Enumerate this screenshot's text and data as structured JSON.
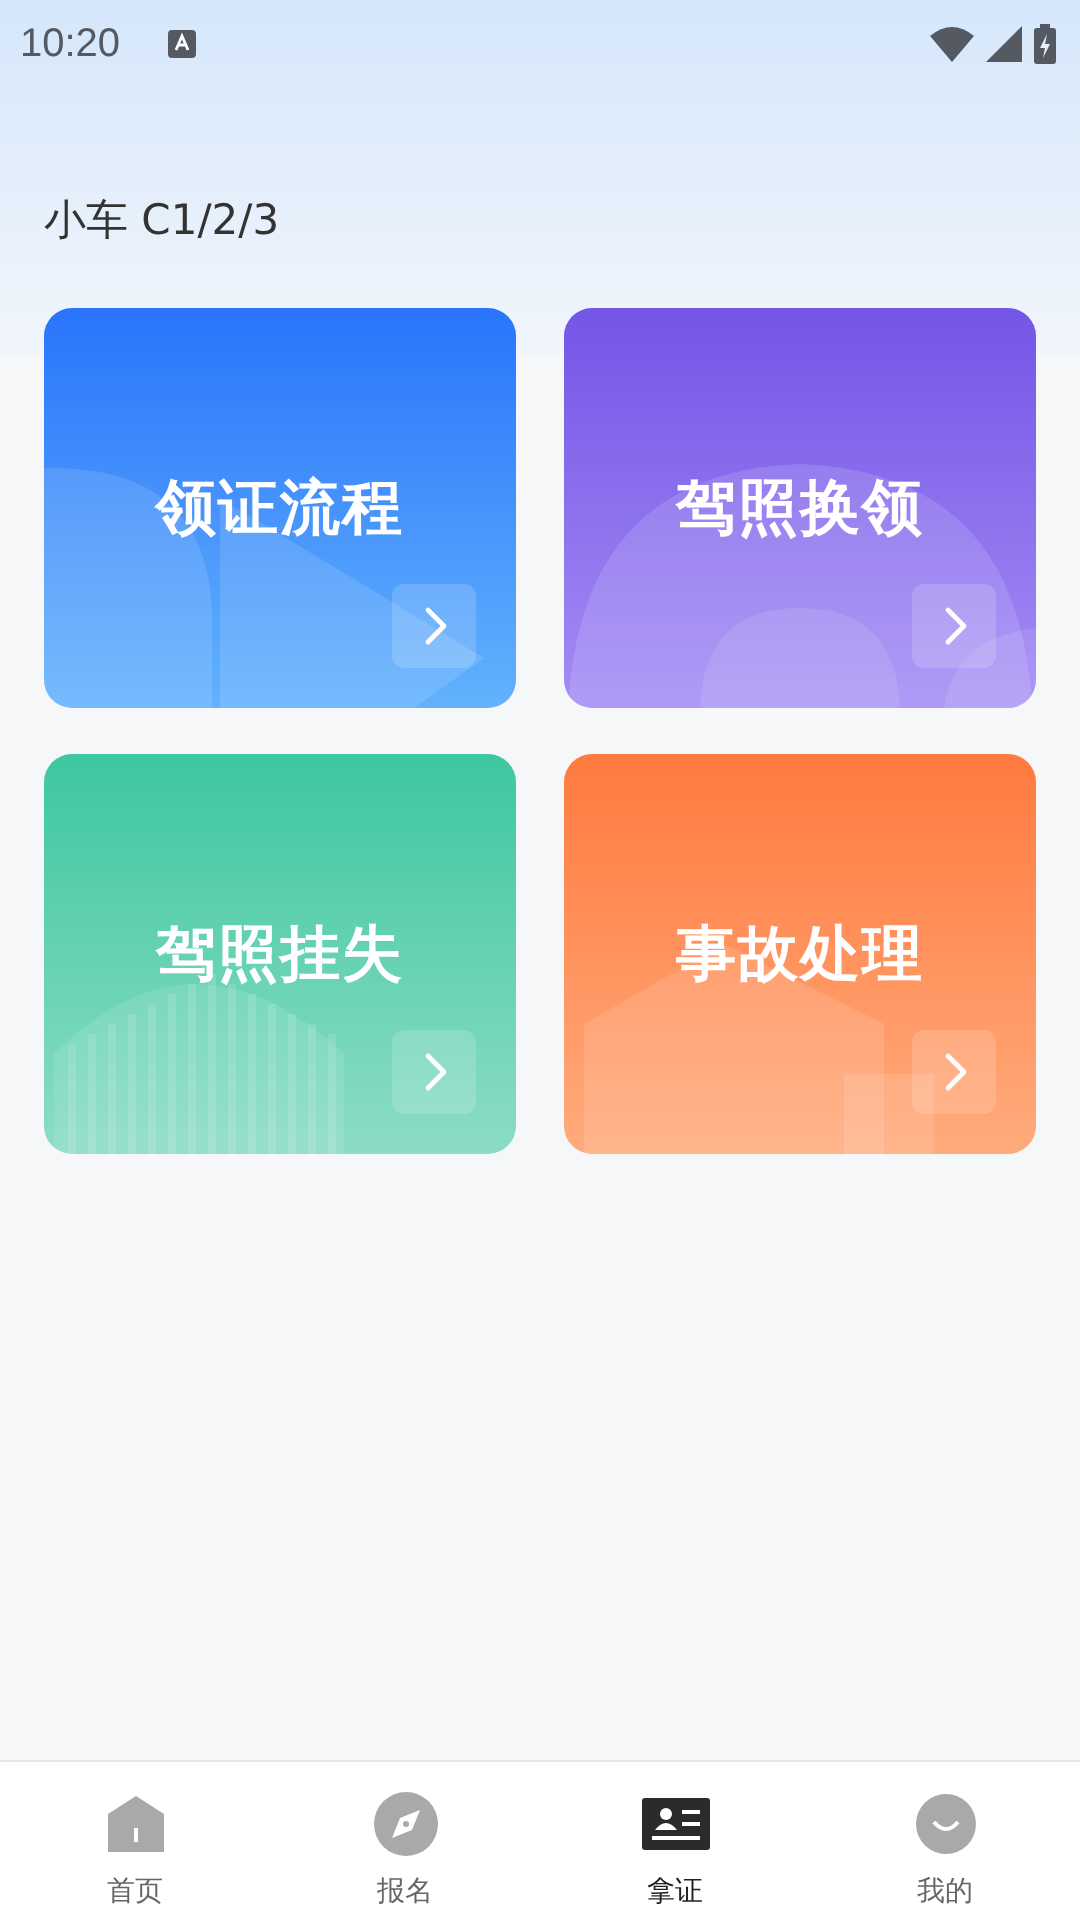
{
  "status_bar": {
    "time": "10:20"
  },
  "title": "小车 C1/2/3",
  "cards": [
    {
      "label": "领证流程",
      "kind": "play"
    },
    {
      "label": "驾照换领",
      "kind": "rings"
    },
    {
      "label": "驾照挂失",
      "kind": "bars"
    },
    {
      "label": "事故处理",
      "kind": "house"
    }
  ],
  "tabs": [
    {
      "label": "首页",
      "kind": "home",
      "selected": false
    },
    {
      "label": "报名",
      "kind": "compass",
      "selected": false
    },
    {
      "label": "拿证",
      "kind": "card",
      "selected": true
    },
    {
      "label": "我的",
      "kind": "person",
      "selected": false
    }
  ]
}
